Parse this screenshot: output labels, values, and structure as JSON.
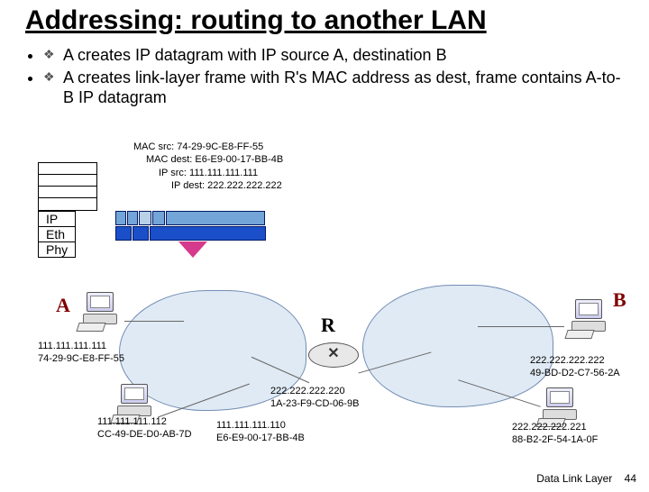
{
  "title": "Addressing: routing to another LAN",
  "bullets": [
    "A creates IP datagram with IP source A, destination B",
    "A creates link-layer frame with R's MAC address as dest, frame contains A-to-B IP datagram"
  ],
  "callout": {
    "l1": "MAC src: 74-29-9C-E8-FF-55",
    "l2": "MAC dest: E6-E9-00-17-BB-4B",
    "l3": "IP src: 111.111.111.111",
    "l4": "IP dest: 222.222.222.222"
  },
  "layers": {
    "ip": "IP",
    "eth": "Eth",
    "phy": "Phy"
  },
  "labels": {
    "A": "A",
    "R": "R",
    "B": "B"
  },
  "nodes": {
    "A": {
      "ip": "111.111.111.111",
      "mac": "74-29-9C-E8-FF-55"
    },
    "Athird": {
      "ip": "111.111.111.112",
      "mac": "CC-49-DE-D0-AB-7D"
    },
    "Rleft": {
      "ip": "111.111.111.110",
      "mac": "E6-E9-00-17-BB-4B"
    },
    "Rright": {
      "ip": "222.222.222.220",
      "mac": "1A-23-F9-CD-06-9B"
    },
    "B": {
      "ip": "222.222.222.222",
      "mac": "49-BD-D2-C7-56-2A"
    },
    "Bthird": {
      "ip": "222.222.222.221",
      "mac": "88-B2-2F-54-1A-0F"
    }
  },
  "footer": {
    "label": "Data Link Layer",
    "page": "44"
  }
}
